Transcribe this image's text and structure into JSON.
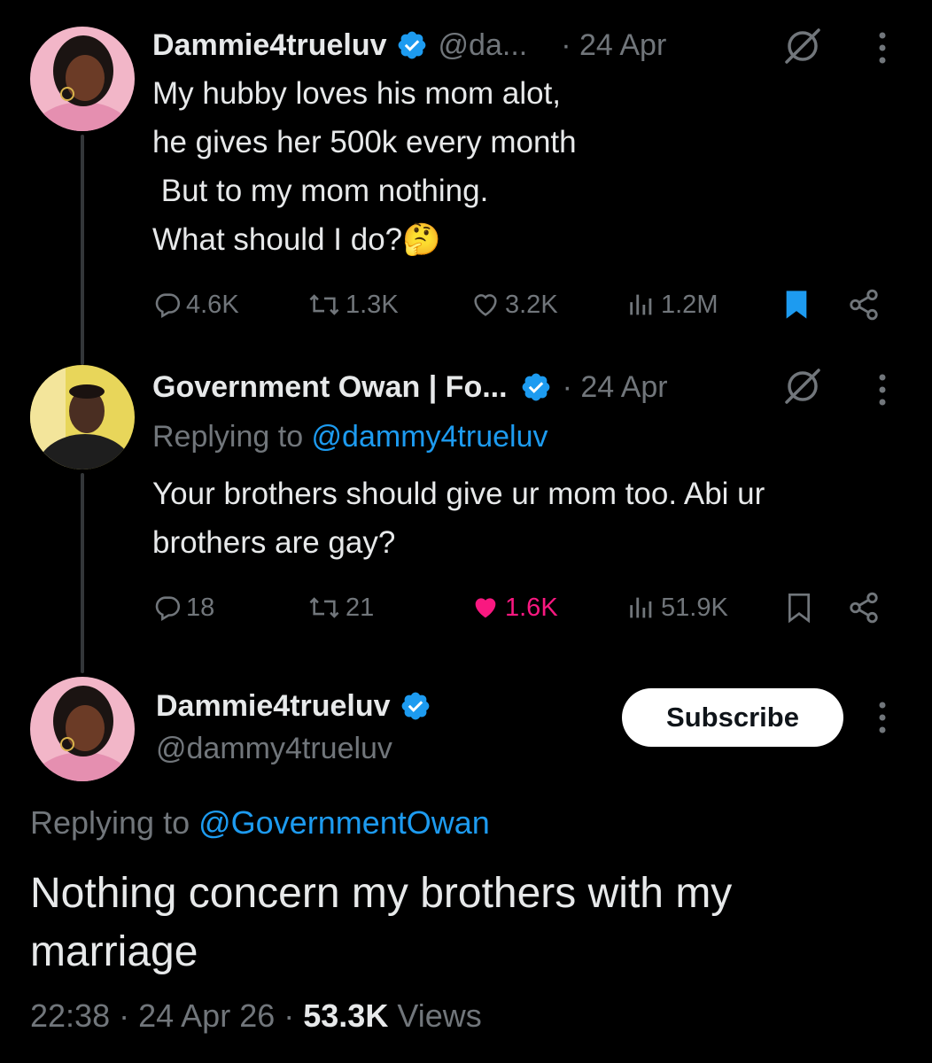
{
  "tweet1": {
    "name": "Dammie4trueluv",
    "handle": "@da...",
    "date": "· 24 Apr",
    "lines": [
      "My hubby loves his mom alot,",
      "he gives her 500k every month",
      " But to my mom nothing.",
      "What should I do?🤔"
    ],
    "replies": "4.6K",
    "reposts": "1.3K",
    "likes": "3.2K",
    "views": "1.2M"
  },
  "tweet2": {
    "name": "Government Owan | Fo...",
    "date": "· 24 Apr",
    "replying_prefix": "Replying to ",
    "replying_handle": "@dammy4trueluv",
    "lines": [
      "Your brothers should give ur mom too. Abi ur",
      "brothers are gay?"
    ],
    "replies": "18",
    "reposts": "21",
    "likes": "1.6K",
    "views": "51.9K"
  },
  "main": {
    "name": "Dammie4trueluv",
    "handle": "@dammy4trueluv",
    "subscribe_label": "Subscribe",
    "replying_prefix": "Replying to ",
    "replying_handle": "@GovernmentOwan",
    "text": "Nothing concern my brothers with my marriage",
    "time": "22:38",
    "date": "24 Apr 26",
    "views_count": "53.3K",
    "views_label": "Views"
  },
  "colors": {
    "background": "#000000",
    "text": "#e7e9ea",
    "muted": "#71767b",
    "link": "#1d9bf0",
    "like": "#f91880",
    "verified": "#1d9bf0"
  },
  "icons": [
    "reply-icon",
    "repost-icon",
    "like-icon",
    "views-icon",
    "bookmark-icon",
    "share-icon",
    "grok-icon",
    "more-icon",
    "verified-badge-icon"
  ]
}
